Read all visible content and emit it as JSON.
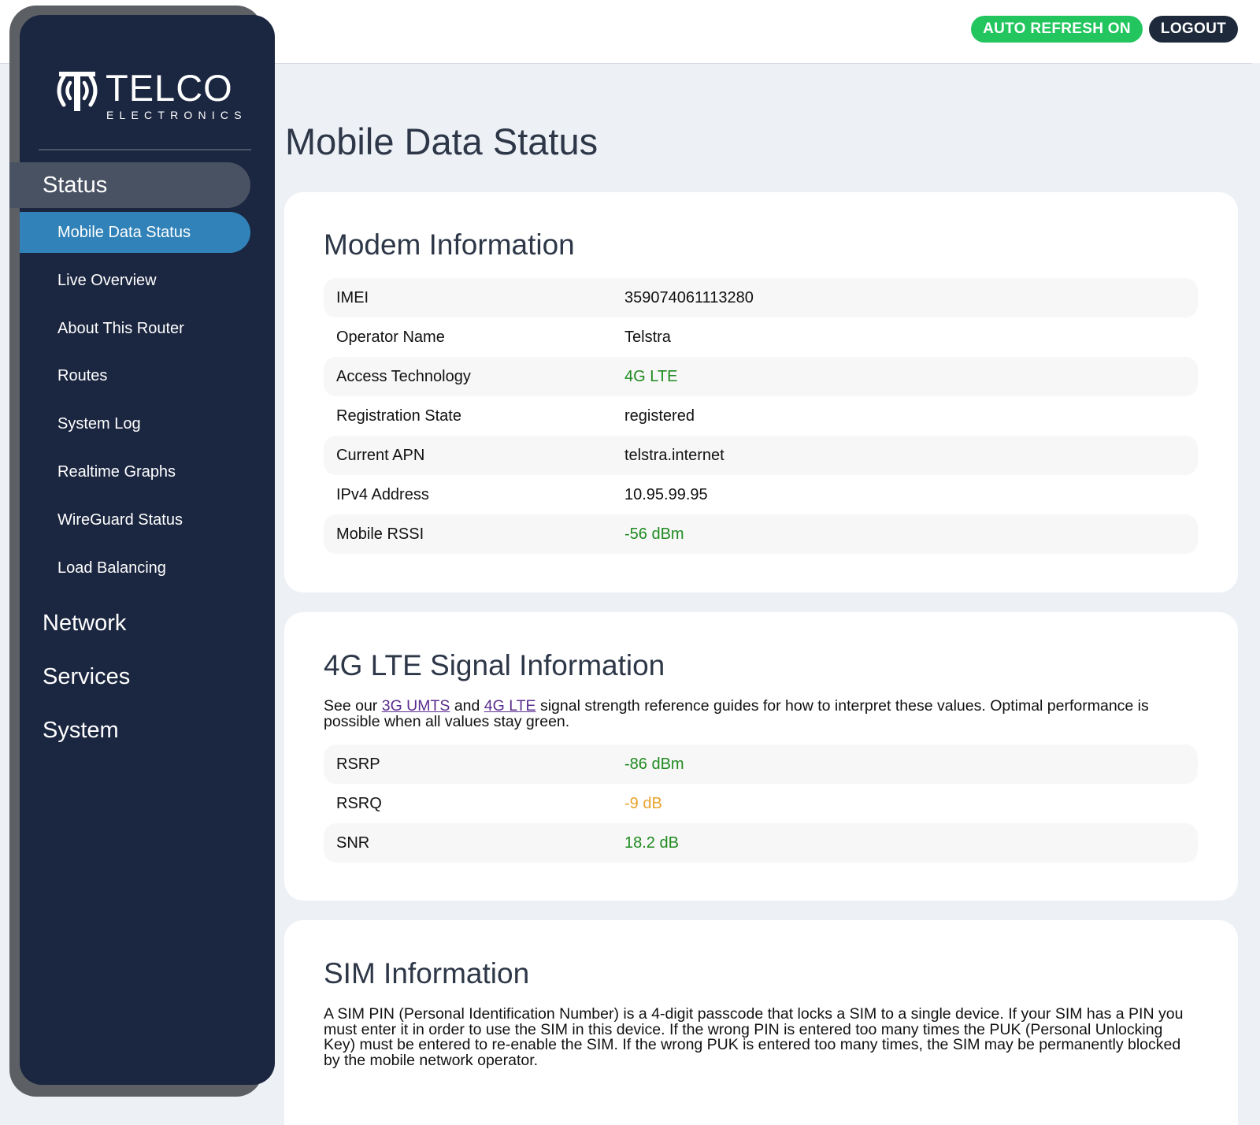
{
  "topbar": {
    "auto_refresh_label": "AUTO REFRESH ON",
    "logout_label": "LOGOUT"
  },
  "brand": {
    "name": "TELCO",
    "subtitle": "ELECTRONICS"
  },
  "sidebar": {
    "section_status": "Status",
    "status_items": [
      {
        "label": "Mobile Data Status"
      },
      {
        "label": "Live Overview"
      },
      {
        "label": "About This Router"
      },
      {
        "label": "Routes"
      },
      {
        "label": "System Log"
      },
      {
        "label": "Realtime Graphs"
      },
      {
        "label": "WireGuard Status"
      },
      {
        "label": "Load Balancing"
      }
    ],
    "section_network": "Network",
    "section_services": "Services",
    "section_system": "System"
  },
  "page": {
    "title": "Mobile Data Status"
  },
  "modem": {
    "title": "Modem Information",
    "rows": [
      {
        "key": "IMEI",
        "value": "359074061113280",
        "color": "#111111"
      },
      {
        "key": "Operator Name",
        "value": "Telstra",
        "color": "#111111"
      },
      {
        "key": "Access Technology",
        "value": "4G LTE",
        "color": "#1f8a1f"
      },
      {
        "key": "Registration State",
        "value": "registered",
        "color": "#111111"
      },
      {
        "key": "Current APN",
        "value": "telstra.internet",
        "color": "#111111"
      },
      {
        "key": "IPv4 Address",
        "value": "10.95.99.95",
        "color": "#111111"
      },
      {
        "key": "Mobile RSSI",
        "value": "-56 dBm",
        "color": "#1f8a1f"
      }
    ]
  },
  "signal": {
    "title": "4G LTE Signal Information",
    "desc_before": "See our ",
    "link_umts": "3G UMTS",
    "desc_mid": " and ",
    "link_lte": "4G LTE",
    "desc_after": " signal strength reference guides for how to interpret these values. Optimal performance is possible when all values stay green.",
    "rows": [
      {
        "key": "RSRP",
        "value": "-86 dBm",
        "color": "#1f8a1f"
      },
      {
        "key": "RSRQ",
        "value": "-9 dB",
        "color": "#e8a22e"
      },
      {
        "key": "SNR",
        "value": "18.2 dB",
        "color": "#1f8a1f"
      }
    ]
  },
  "sim": {
    "title": "SIM Information",
    "desc": "A SIM PIN (Personal Identification Number) is a 4-digit passcode that locks a SIM to a single device. If your SIM has a PIN you must enter it in order to use the SIM in this device. If the wrong PIN is entered too many times the PUK (Personal Unlocking Key) must be entered to re-enable the SIM. If the wrong PUK is entered too many times, the SIM may be permanently blocked by the mobile network operator."
  }
}
